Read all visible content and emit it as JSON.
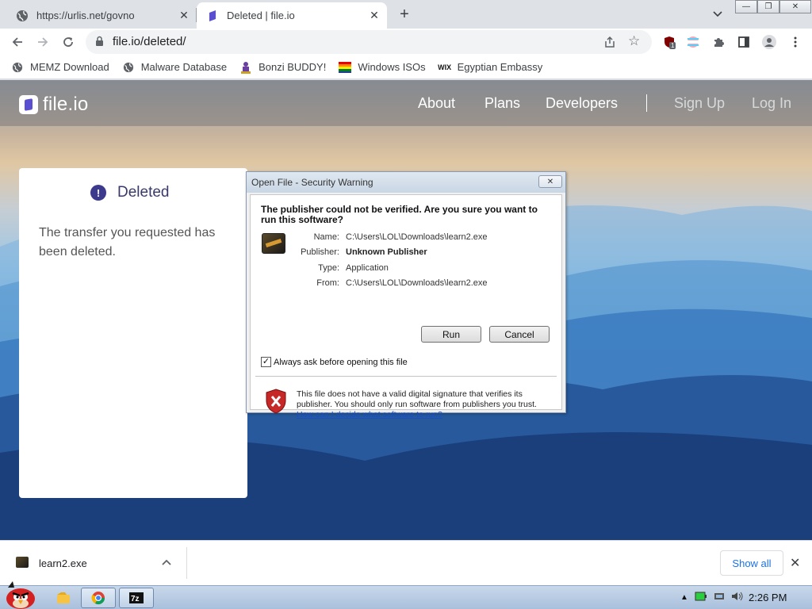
{
  "browser": {
    "tabs": [
      {
        "title": "https://urlis.net/govno",
        "icon": "globe-icon",
        "active": false
      },
      {
        "title": "Deleted | file.io",
        "icon": "fileio-favicon-icon",
        "active": true
      }
    ],
    "address": "file.io/deleted/",
    "bookmarks": [
      {
        "label": "MEMZ Download",
        "icon": "globe-icon"
      },
      {
        "label": "Malware Database",
        "icon": "globe-icon"
      },
      {
        "label": "Bonzi BUDDY!",
        "icon": "bonzi-icon"
      },
      {
        "label": "Windows ISOs",
        "icon": "windows-flag-icon"
      },
      {
        "label": "Egyptian Embassy",
        "icon": "wix-icon"
      }
    ],
    "extension_badge": "1"
  },
  "site": {
    "brand": "file.io",
    "nav": [
      "About",
      "Plans",
      "Developers"
    ],
    "auth": [
      "Sign Up",
      "Log In"
    ],
    "card": {
      "heading": "Deleted",
      "message": "The transfer you requested has been deleted."
    }
  },
  "dialog": {
    "title": "Open File - Security Warning",
    "question": "The publisher could not be verified.  Are you sure you want to run this software?",
    "fields": [
      {
        "label": "Name:",
        "value": "C:\\Users\\LOL\\Downloads\\learn2.exe",
        "bold": false
      },
      {
        "label": "Publisher:",
        "value": "Unknown Publisher",
        "bold": true
      },
      {
        "label": "Type:",
        "value": "Application",
        "bold": false
      },
      {
        "label": "From:",
        "value": "C:\\Users\\LOL\\Downloads\\learn2.exe",
        "bold": false
      }
    ],
    "run_label": "Run",
    "cancel_label": "Cancel",
    "checkbox_label": "Always ask before opening this file",
    "checkbox_checked": true,
    "warning_text": "This file does not have a valid digital signature that verifies its publisher.  You should only run software from publishers you trust.",
    "help_link": "How can I decide what software to run?"
  },
  "downloads": {
    "filename": "learn2.exe",
    "show_all": "Show all"
  },
  "taskbar": {
    "time": "2:26 PM"
  }
}
